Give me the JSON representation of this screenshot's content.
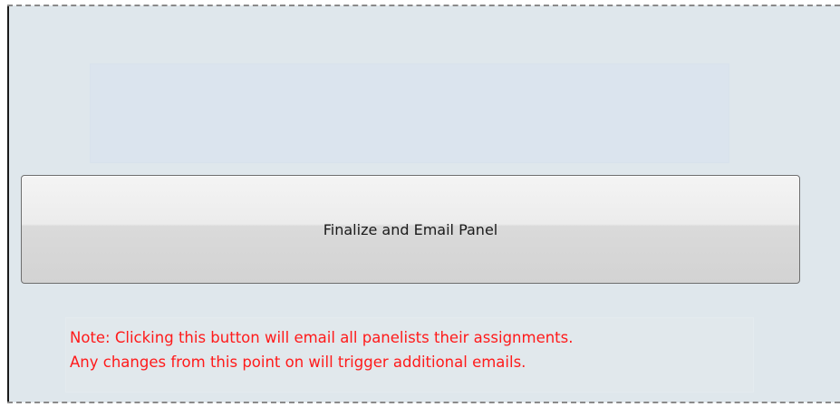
{
  "panel": {
    "finalize_button_label": "Finalize and Email Panel",
    "note_lines": [
      "Note: Clicking this button will email all panelists their assignments.",
      "Any changes from this point on will trigger additional emails."
    ]
  },
  "colors": {
    "panel_background": "#dfe7ec",
    "note_text": "#ff1a1a",
    "button_border": "#6e6e6e"
  }
}
